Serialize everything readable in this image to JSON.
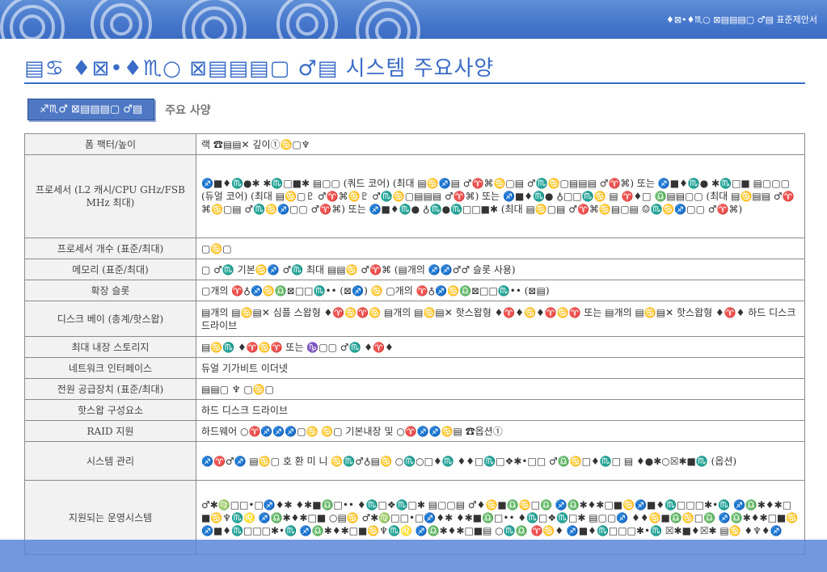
{
  "header": {
    "right_text": "♦⊠•♦♏○ ⊠▤▤▤▢ ♂▤ 표준제안서"
  },
  "title": "▤♋ ♦⊠•♦♏○ ⊠▤▤▤▢ ♂▤ 시스템 주요사양",
  "section": {
    "tab_label": "♐♏♂ ⊠▤▤▤▢ ♂▤",
    "label": "주요 사양"
  },
  "rows": [
    {
      "key": "폼 팩터/높이",
      "value": "랙 ☎▤▤✕ 깊이①♋▢♆"
    },
    {
      "key": "프로세서 (L2 캐시/CPU GHz/FSB MHz 최대)",
      "value": "♐■♦♏●✱ ✱♏□■✱ ▤▢▢ (쿼드 코어) (최대 ▤♋♐▤ ♂♈⌘♋▢▤ ♂♏♋▢▤▤▤ ♂♈⌘) 또는 ♐■♦♏● ✱♏□■ ▤▢▢▢ (듀얼 코어) (최대 ▤♋▢♇ ♂♈⌘♋♇ ♂♏♋▢▤▤▤ ♂♈⌘) 또는 ♐■♦♏● ♁□□♏♋ ▤ ♈♦□ ♎▤▤▢▢ (최대 ▤♋▤▤ ♂♈⌘♋▢▤ ♂♏♋♐▢▢ ♂♈⌘) 또는 ♐■♦♏● ♁♏●♏□□■✱ (최대 ▤♋▢▤ ♂♈⌘♋▤▢▤ ☺♏♋♐▢▢ ♂♈⌘)"
    },
    {
      "key": "프로세서 개수 (표준/최대)",
      "value": "▢♋▢"
    },
    {
      "key": "메모리 (표준/최대)",
      "value": "▢ ♂♏ 기본♋♐ ♂♏ 최대 ▤▤♋ ♂♈⌘ (▤개의 ♐♐♂♂ 슬롯 사용)"
    },
    {
      "key": "확장 슬롯",
      "value": "▢개의 ♈♁♐♋♎⊠□□♏•• (⊠♐) ♋ ▢개의 ♈♁♐♋♎⊠□□♏•• (⊠▤)"
    },
    {
      "key": "디스크 베이 (총계/핫스왑)",
      "value": "▤개의 ▤♋▤✕ 심플 스왑형 ♦♈♋♈♋ ▤개의 ▤♋▤✕ 핫스왑형 ♦♈♦♋♦♈♋♈ 또는 ▤개의 ▤♋▤✕ 핫스왑형 ♦♈♦ 하드 디스크 드라이브"
    },
    {
      "key": "최대 내장 스토리지",
      "value": "▤♋♏ ♦♈♋♈ 또는 ♑▢▢ ♂♏ ♦♈♦"
    },
    {
      "key": "네트워크 인터페이스",
      "value": "듀얼 기가비트 이더넷"
    },
    {
      "key": "전원 공급장치 (표준/최대)",
      "value": "▤▤▢ ♆ ▢♋▢"
    },
    {
      "key": "핫스왑 구성요소",
      "value": "하드 디스크 드라이브"
    },
    {
      "key": "RAID 지원",
      "value": "하드웨어 ○♈♐♐♐▢♋ ♋▢ 기본내장 및 ○♈♐♐♋▤ ☎옵션①"
    },
    {
      "key": "시스템 관리",
      "value": "♐♈♂♐ ▤♋▢ 호 환 미 니 ♋♏♂♁▤♋ ○♏○□♦♏ ♦♦□♏□❖✱•□□ ♂♎♋□♦♏□ ▤ ♦●✱○☒✱■♏ (옵션)"
    },
    {
      "key": "지원되는 운영시스템",
      "value": "♂✱♍□□•□♐♦✱ ♦✱■♎□•• ♦♏□❖♏□✱ ▤▢▢▤ ♂♦♋■♎♋□♎ ♐♎✱♦✱□■♋♐■♦♏□□□✱•♏ ♐♎✱♦✱□■♋♆♏♌ ♐♎✱♦✱□■ ○▤♋ ♂✱♍□□•□♐♦✱ ♦✱■♎□•• ♦♏□❖♏□✱ ▤▢▢♐ ♦♦♋■♎♋□♎ ♐♎✱♦✱□■♋♐■♦♏□□□✱•♏ ♐♎✱♦✱□■♋♆♏♌ ♐♎✱♦✱□■▤ ○♏♎ ♈♋♦ ♐■♦♏□□□✱•♏ ☒✱■♦☒✱ ▤♋ ♦♆♦♐"
    }
  ]
}
